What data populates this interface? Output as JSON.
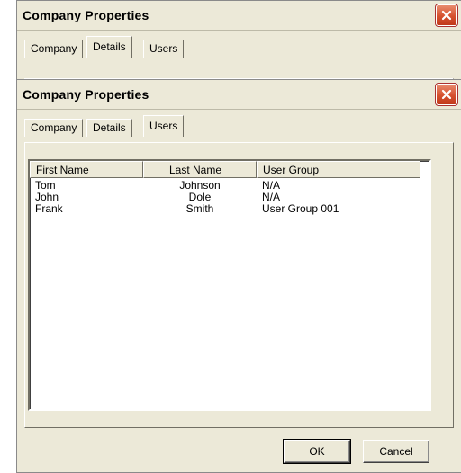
{
  "back_window": {
    "title": "Company Properties",
    "tabs": [
      "Company",
      "Details",
      "Users"
    ],
    "active_tab": "Details"
  },
  "front_window": {
    "title": "Company Properties",
    "tabs": [
      "Company",
      "Details",
      "Users"
    ],
    "active_tab": "Users",
    "columns": [
      "First Name",
      "Last Name",
      "User Group"
    ],
    "rows": [
      [
        "Tom",
        "Johnson",
        "N/A"
      ],
      [
        "John",
        "Dole",
        "N/A"
      ],
      [
        "Frank",
        "Smith",
        "User Group 001"
      ]
    ],
    "ok_label": "OK",
    "cancel_label": "Cancel"
  },
  "icons": {
    "close": "close-icon"
  },
  "colors": {
    "dialog_bg": "#ece9d8",
    "close_button": "#d6512f"
  }
}
